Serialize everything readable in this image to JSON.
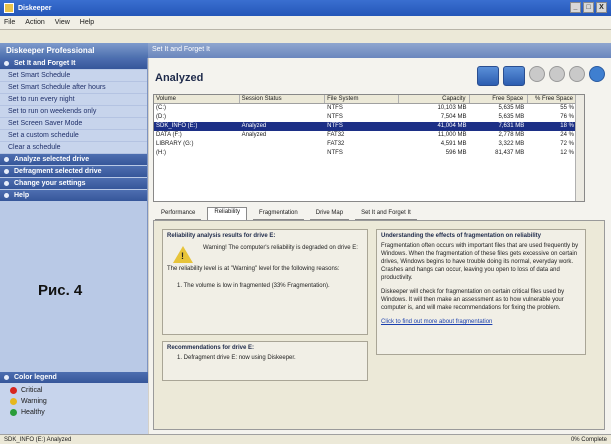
{
  "window": {
    "title": "Diskeeper",
    "controls": [
      "_",
      "□",
      "X"
    ]
  },
  "menu": [
    "File",
    "Action",
    "View",
    "Help"
  ],
  "app": {
    "title": "Diskeeper Professional",
    "right_title": "Set It and Forget It"
  },
  "sidebar": {
    "sections": [
      {
        "label": "Set It and Forget It",
        "items": [
          "Set Smart Schedule",
          "Set Smart Schedule after hours",
          "Set to run every night",
          "Set to run on weekends only",
          "Set Screen Saver Mode",
          "Set a custom schedule",
          "Clear a schedule"
        ]
      },
      {
        "label": "Analyze selected drive"
      },
      {
        "label": "Defragment selected drive"
      },
      {
        "label": "Change your settings"
      },
      {
        "label": "Help"
      }
    ],
    "figure_label": "Рис. 4",
    "legend": {
      "title": "Color legend",
      "items": [
        {
          "label": "Critical",
          "color": "#d7261e"
        },
        {
          "label": "Warning",
          "color": "#e6b71e"
        },
        {
          "label": "Healthy",
          "color": "#2a9d3a"
        }
      ]
    }
  },
  "main": {
    "title": "Analyzed",
    "toolbar_icons": [
      "analyze-icon",
      "defragment-icon",
      "stop-icon",
      "pause-icon",
      "schedule-icon",
      "help-icon"
    ],
    "table": {
      "headers": [
        "Volume",
        "Session Status",
        "File System",
        "Capacity",
        "Free Space",
        "% Free Space"
      ],
      "rows": [
        [
          "(C:)",
          "",
          "NTFS",
          "10,103 MB",
          "5,635 MB",
          "55 %"
        ],
        [
          "(D:)",
          "",
          "NTFS",
          "7,504 MB",
          "5,635 MB",
          "76 %"
        ],
        [
          "SDK_INFO (E:)",
          "Analyzed",
          "NTFS",
          "41,004 MB",
          "7,631 MB",
          "18 %"
        ],
        [
          "DATA (F:)",
          "Analyzed",
          "FAT32",
          "11,000 MB",
          "2,778 MB",
          "24 %"
        ],
        [
          "LIBRARY (G:)",
          "",
          "FAT32",
          "4,591 MB",
          "3,322 MB",
          "72 %"
        ],
        [
          "(H:)",
          "",
          "NTFS",
          "596 MB",
          "81,437 MB",
          "12 %"
        ]
      ],
      "selected_row": 2
    },
    "tabs": [
      "Performance",
      "Reliability",
      "Fragmentation",
      "Drive Map",
      "Set It and Forget It"
    ],
    "active_tab": 1,
    "reliability": {
      "title": "Reliability analysis results for drive E:",
      "warning_text": "Warning! The computer's reliability is degraded on drive E:",
      "level_text": "The reliability level is at \"Warning\" level for the following reasons:",
      "reason": "1. The volume is low in fragmented (33% Fragmentation)."
    },
    "recommendations": {
      "title": "Recommendations for drive E:",
      "text": "1. Defragment drive E: now using Diskeeper."
    },
    "understanding": {
      "title": "Understanding the effects of fragmentation on reliability",
      "p1": "Fragmentation often occurs with important files that are used frequently by Windows. When the fragmentation of these files gets excessive on certain drives, Windows begins to have trouble doing its normal, everyday work. Crashes and hangs can occur, leaving you open to loss of data and productivity.",
      "p2": "Diskeeper will check for fragmentation on certain critical files used by Windows. It will then make an assessment as to how vulnerable your computer is, and will make recommendations for fixing the problem.",
      "link": "Click to find out more about fragmentation"
    }
  },
  "status": {
    "left": "SDK_INFO (E:) Analyzed",
    "right": "0% Complete"
  }
}
